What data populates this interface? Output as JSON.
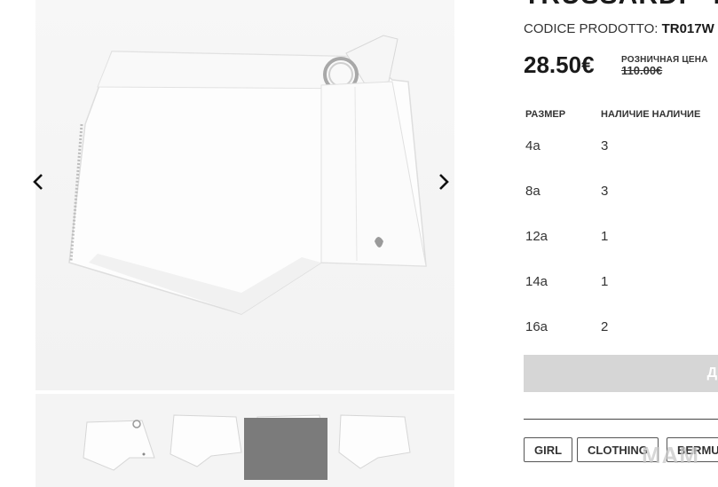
{
  "gallery": {
    "prev_icon": "chevron-left-icon",
    "next_icon": "chevron-right-icon",
    "thumbnail_count": 4
  },
  "product": {
    "title": "TRUSSARDI - B",
    "code_label": "CODICE PRODOTTO:",
    "code_value": "TR017W",
    "price": "28.50€",
    "retail_label": "РОЗНИЧНАЯ ЦЕНА",
    "retail_price": "110.00€"
  },
  "sizes": {
    "header_size": "РАЗМЕР",
    "header_availability": "НАЛИЧИЕ НАЛИЧИЕ",
    "rows": [
      {
        "size": "4a",
        "qty": "3"
      },
      {
        "size": "8a",
        "qty": "3"
      },
      {
        "size": "12a",
        "qty": "1"
      },
      {
        "size": "14a",
        "qty": "1"
      },
      {
        "size": "16a",
        "qty": "2"
      }
    ]
  },
  "add_button_label": "Д",
  "tags": [
    "GIRL",
    "CLOTHING",
    "BERMU"
  ],
  "watermark": "МАМ",
  "colors": {
    "button_bg": "#d6d6d6",
    "thumb_overlay": "#7b7b7b",
    "text": "#222222"
  }
}
